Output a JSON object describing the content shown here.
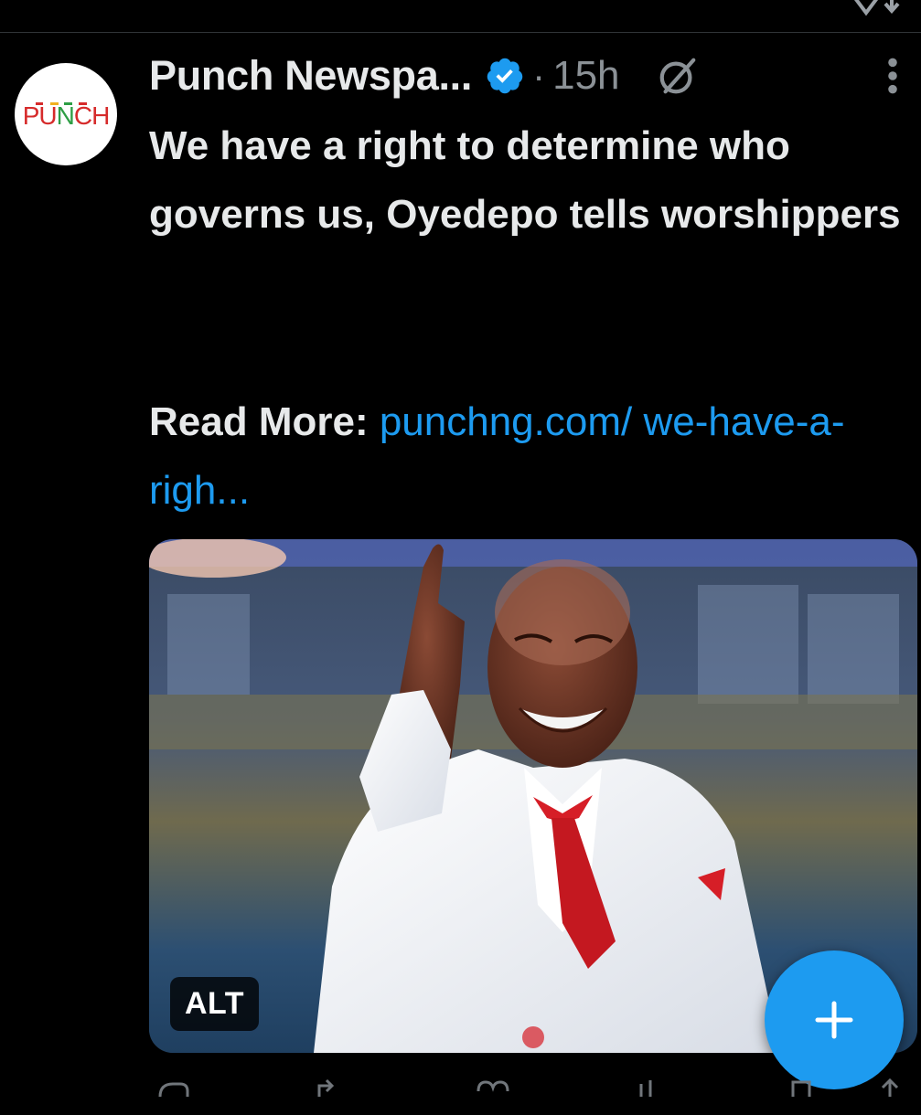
{
  "post": {
    "author_name": "Punch Newspa...",
    "time": "15h",
    "separator": "·",
    "text": "We have a right to determine who governs us, Oyedepo tells worshippers",
    "read_more_label": "Read More:",
    "link_text": "punchng.com/ we-have-a-righ...",
    "alt_badge": "ALT"
  },
  "avatar": {
    "logo_text": "PUNCH",
    "colors": [
      "#d62b2b",
      "#d62b2b",
      "#2e9e45",
      "#2e9e45",
      "#d62b2b"
    ]
  },
  "icons": {
    "verified": "verified-badge-icon",
    "grok": "grok-icon",
    "more": "more-icon",
    "compose": "plus-icon"
  },
  "colors": {
    "background": "#000000",
    "text": "#e7e9ea",
    "muted": "#8b9196",
    "link": "#1d9bf0",
    "fab": "#1d9bf0"
  }
}
